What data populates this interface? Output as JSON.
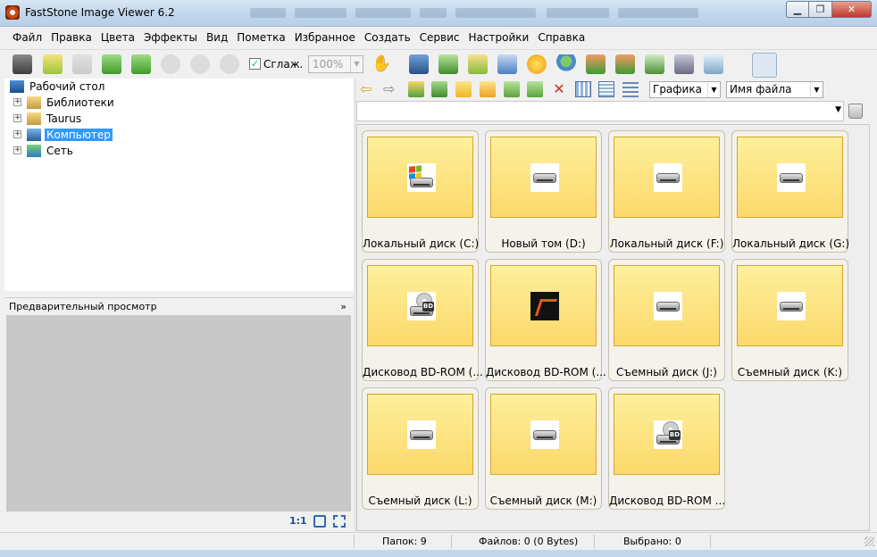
{
  "window": {
    "title": "FastStone Image Viewer 6.2",
    "min": "▁",
    "max": "❐",
    "close": "✕"
  },
  "menu": [
    "Файл",
    "Правка",
    "Цвета",
    "Эффекты",
    "Вид",
    "Пометка",
    "Избранное",
    "Создать",
    "Сервис",
    "Настройки",
    "Справка"
  ],
  "toolbar": {
    "smooth_label": "Сглаж.",
    "smooth_checked": "✓",
    "zoom_value": "100%",
    "icons": [
      "open-camera-icon",
      "open-folder-icon",
      "save-icon",
      "previous-image-icon",
      "next-image-icon",
      "zoom-in-icon",
      "zoom-out-icon",
      "actual-size-icon",
      "hand-pan-icon",
      "slideshow-icon",
      "download-icon",
      "crop-icon",
      "color-balance-icon",
      "brightness-icon",
      "stamp-icon",
      "rotate-left-icon",
      "rotate-right-icon",
      "compare-icon",
      "print-icon",
      "email-icon",
      "layout-browser-icon",
      "layout-details-icon",
      "layout-portrait-icon",
      "fullscreen-icon"
    ]
  },
  "tree": {
    "root": "Рабочий стол",
    "items": [
      {
        "label": "Библиотеки",
        "icon": "libraries-icon"
      },
      {
        "label": "Taurus",
        "icon": "user-folder-icon"
      },
      {
        "label": "Компьютер",
        "icon": "computer-icon",
        "selected": true
      },
      {
        "label": "Сеть",
        "icon": "network-icon"
      }
    ]
  },
  "preview": {
    "title": "Предварительный просмотр",
    "ratio_label": "1:1"
  },
  "browser": {
    "filter": "Графика",
    "sort": "Имя файла",
    "path": "",
    "icons": [
      "back-icon",
      "forward-icon",
      "up-folder-icon",
      "refresh-icon",
      "favorites-icon",
      "new-folder-icon",
      "copy-to-icon",
      "move-to-icon",
      "delete-icon",
      "thumbnails-view-icon",
      "list-view-icon",
      "details-view-icon"
    ]
  },
  "thumbnails": [
    {
      "label": "Локальный диск (C:)",
      "icon": "system-drive-icon"
    },
    {
      "label": "Новый том (D:)",
      "icon": "hard-drive-icon"
    },
    {
      "label": "Локальный диск (F:)",
      "icon": "hard-drive-icon"
    },
    {
      "label": "Локальный диск (G:)",
      "icon": "hard-drive-icon"
    },
    {
      "label": "Дисковод BD-ROM (...",
      "icon": "bd-rom-icon"
    },
    {
      "label": "Дисковод BD-ROM (...",
      "icon": "game-disc-icon"
    },
    {
      "label": "Съемный диск (J:)",
      "icon": "removable-drive-icon"
    },
    {
      "label": "Съемный диск (K:)",
      "icon": "removable-drive-icon"
    },
    {
      "label": "Съемный диск (L:)",
      "icon": "removable-drive-icon"
    },
    {
      "label": "Съемный диск (M:)",
      "icon": "removable-drive-icon"
    },
    {
      "label": "Дисковод BD-ROM ...",
      "icon": "bd-rom-icon"
    }
  ],
  "status": {
    "folders": "Папок: 9",
    "files": "Файлов: 0 (0 Bytes)",
    "selected": "Выбрано: 0"
  },
  "colors": {
    "selection": "#3399ff",
    "thumb_top": "#fef09c",
    "thumb_bottom": "#fbd86a",
    "thumb_border": "#d4a72c"
  }
}
